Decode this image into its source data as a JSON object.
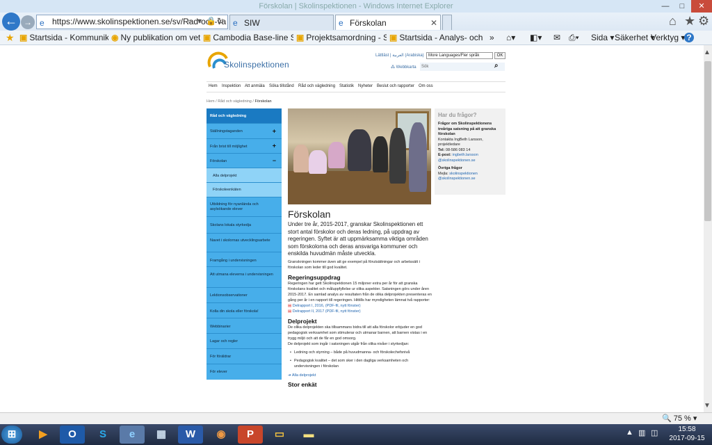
{
  "browser": {
    "title": "Förskolan | Skolinspektionen - Windows Internet Explorer",
    "address": "https://www.skolinspektionen.se/sv/Rad-och-va",
    "tabs": [
      {
        "label": "SIW"
      },
      {
        "label": "Förskolan",
        "active": true
      }
    ],
    "favorites": [
      "Startsida - Kommunikation",
      "Ny publikation om vetens...",
      "Cambodia Base-line Stud...",
      "Projektsamordning - Start...",
      "Startsida - Analys- och sta..."
    ],
    "commands": {
      "page": "Sida",
      "safety": "Säkerhet",
      "tools": "Verktyg",
      "help": "?"
    },
    "zoom": "75 %",
    "clock_time": "15:58",
    "clock_date": "2017-09-15",
    "accent_color": "#2f78c8"
  },
  "site": {
    "logo_text": "Skolinspektionen",
    "lang_links": "Lättläst | العربية (Arabiska)",
    "lang_select": "More Languages/Fler språk",
    "ok_label": "OK",
    "sitemap_label": "Webbkarta",
    "search_placeholder": "Sök",
    "topnav": [
      "Hem",
      "Inspektion",
      "Att anmäla",
      "Söka tillstånd",
      "Råd och vägledning",
      "Statistik",
      "Nyheter",
      "Beslut och rapporter",
      "Om oss"
    ],
    "breadcrumb": {
      "home": "Hem",
      "sep1": " / ",
      "parent": "Råd och vägledning",
      "sep2": " / ",
      "current": "Förskolan"
    },
    "sidenav": [
      {
        "label": "Råd och vägledning",
        "kind": "hdr"
      },
      {
        "label": "Ställningstaganden",
        "kind": "item",
        "expand": "+"
      },
      {
        "label": "Från brist till möjlighet",
        "kind": "item",
        "expand": "+"
      },
      {
        "label": "Förskolan",
        "kind": "item",
        "expand": "–"
      },
      {
        "label": "Alla delprojekt",
        "kind": "sub"
      },
      {
        "label": "Förskoleenkäten",
        "kind": "sub"
      },
      {
        "label": "Utbildning för nyanlända och asylsökande elever",
        "kind": "item"
      },
      {
        "label": "Skolans lokala styrkedja",
        "kind": "item"
      },
      {
        "label": "Navet i skolornas utvecklingsarbete",
        "kind": "item"
      },
      {
        "label": "Framgång i undervisningen",
        "kind": "item"
      },
      {
        "label": "Att utmana eleverna i undervisningen",
        "kind": "item"
      },
      {
        "label": "Lektionsobservationer",
        "kind": "item"
      },
      {
        "label": "Kolla din skola eller förskola!",
        "kind": "item"
      },
      {
        "label": "Webbinarier",
        "kind": "item"
      },
      {
        "label": "Lagar och regler",
        "kind": "item"
      },
      {
        "label": "För föräldrar",
        "kind": "item"
      },
      {
        "label": "För elever",
        "kind": "item"
      }
    ],
    "sidebox": {
      "title": "Har du frågor?",
      "heading": "Frågor om Skolinspektionens treåriga satsning på att granska förskolan",
      "contact": "Kontakta IngBeth Larsson, projektledare",
      "tel_label": "Tel:",
      "tel": "08-586 083 14",
      "email_label": "E-post:",
      "email": "ingbeth.larsson @skolinspektionen.se",
      "other_heading": "Övriga frågor",
      "other_text": "Mejla:",
      "other_email": "skolinspektionen @skolinspektionen.se"
    },
    "main": {
      "title": "Förskolan",
      "intro": "Under tre år, 2015-2017, granskar Skolinspektionen ett stort antal förskolor och deras ledning, på uppdrag av regeringen. Syftet är att uppmärksamma viktiga områden som förskolorna och deras ansvariga kommuner och enskilda huvudmän måste utveckla.",
      "intro_small": "Granskningen kommer även att ge exempel på förutsättningar och arbetssätt i förskolan som leder till god kvalitet.",
      "h2_1": "Regeringsuppdrag",
      "p1": "Regeringen har gett Skolinspektionen 15 miljoner extra per år för att granska förskolans kvalitet och måluppfyllelse ur olika aspekter. Satsningen görs under åren 2015-2017. En samlad analys av resultaten från de olika delprojekten presenteras en gång per år i en rapport till regeringen. Hittills har myndigheten lämnat två rapporter:",
      "pdf1": "Delrapport I, 2016, (PDF-fil, nytt fönster)",
      "pdf2": "Delrapport II, 2017 (PDF-fil, nytt fönster)",
      "h2_2": "Delprojekt",
      "p2": "De olika delprojekten ska tillsammans bidra till att alla förskolor erbjuder en god pedagogisk verksamhet som stimulerar och utmanar barnen, att barnen vistas i en trygg miljö och att de får en god omsorg.",
      "p3": "De delprojekt som ingår i satsningen utgår från olika nivåer i styrkedjan:",
      "bullets": [
        "Ledning och styrning – både på huvudmanna- och förskolechefsnivå",
        "Pedagogisk kvalitet – det som sker i den dagliga verksamheten och undervisningen i förskolan"
      ],
      "all_link": "Alla delprojekt",
      "h2_3": "Stor enkät"
    }
  }
}
